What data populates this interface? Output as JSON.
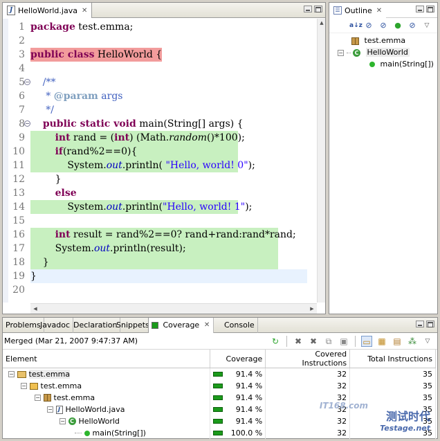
{
  "editor": {
    "tab_label": "HelloWorld.java",
    "line_numbers": [
      "1",
      "2",
      "3",
      "4",
      "5",
      "6",
      "7",
      "8",
      "9",
      "10",
      "11",
      "12",
      "13",
      "14",
      "15",
      "16",
      "17",
      "18",
      "19",
      "20"
    ]
  },
  "outline": {
    "tab_label": "Outline",
    "toolbar_icons": [
      "sort-alpha-icon",
      "hide-fields-icon",
      "hide-static-icon",
      "hide-nonpublic-icon",
      "hide-local-types-icon",
      "view-menu-icon"
    ],
    "items": [
      {
        "label": "test.emma",
        "icon": "package-icon"
      },
      {
        "label": "HelloWorld",
        "icon": "class-icon"
      },
      {
        "label": "main(String[])",
        "icon": "method-icon"
      }
    ]
  },
  "bottom": {
    "tabs": [
      "Problems",
      "Javadoc",
      "Declaration",
      "Snippets",
      "Coverage",
      "Console"
    ],
    "session_label": "Merged (Mar 21, 2007 9:47:37 AM)",
    "columns": [
      "Element",
      "Coverage",
      "Covered Instructions",
      "Total Instructions"
    ],
    "rows": [
      {
        "element": "test.emma",
        "icon": "project-icon",
        "coverage": "91.4 %",
        "covered": "32",
        "total": "35"
      },
      {
        "element": "test.emma",
        "icon": "source-folder-icon",
        "coverage": "91.4 %",
        "covered": "32",
        "total": "35"
      },
      {
        "element": "test.emma",
        "icon": "package-icon",
        "coverage": "91.4 %",
        "covered": "32",
        "total": "35"
      },
      {
        "element": "HelloWorld.java",
        "icon": "java-file-icon",
        "coverage": "91.4 %",
        "covered": "32",
        "total": "35"
      },
      {
        "element": "HelloWorld",
        "icon": "class-icon",
        "coverage": "91.4 %",
        "covered": "32",
        "total": "35"
      },
      {
        "element": "main(String[])",
        "icon": "method-icon",
        "coverage": "100.0 %",
        "covered": "32",
        "total": "35"
      }
    ]
  },
  "watermark": {
    "text1": "IT168.com",
    "text2": "测试时代",
    "text3": "Testage.net"
  },
  "colors": {
    "covered_line": "#c8f0c0",
    "uncovered_line": "#f29c9c",
    "keyword": "#7f0055",
    "string": "#2a00ff",
    "coverage_bar": "#1b9a1b"
  }
}
